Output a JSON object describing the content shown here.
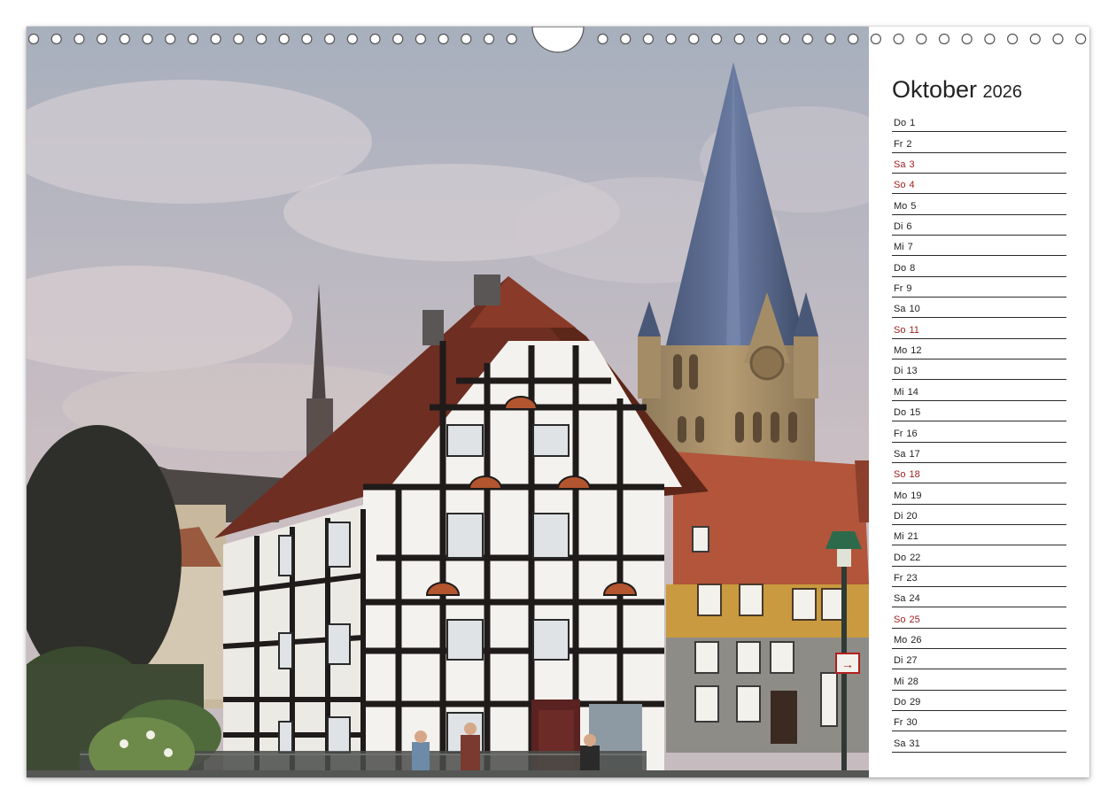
{
  "calendar": {
    "month": "Oktober",
    "year": "2026",
    "days": [
      {
        "wd": "Do",
        "n": "1",
        "weekend": false
      },
      {
        "wd": "Fr",
        "n": "2",
        "weekend": false
      },
      {
        "wd": "Sa",
        "n": "3",
        "weekend": true
      },
      {
        "wd": "So",
        "n": "4",
        "weekend": true
      },
      {
        "wd": "Mo",
        "n": "5",
        "weekend": false
      },
      {
        "wd": "Di",
        "n": "6",
        "weekend": false
      },
      {
        "wd": "Mi",
        "n": "7",
        "weekend": false
      },
      {
        "wd": "Do",
        "n": "8",
        "weekend": false
      },
      {
        "wd": "Fr",
        "n": "9",
        "weekend": false
      },
      {
        "wd": "Sa",
        "n": "10",
        "weekend": false
      },
      {
        "wd": "So",
        "n": "11",
        "weekend": true
      },
      {
        "wd": "Mo",
        "n": "12",
        "weekend": false
      },
      {
        "wd": "Di",
        "n": "13",
        "weekend": false
      },
      {
        "wd": "Mi",
        "n": "14",
        "weekend": false
      },
      {
        "wd": "Do",
        "n": "15",
        "weekend": false
      },
      {
        "wd": "Fr",
        "n": "16",
        "weekend": false
      },
      {
        "wd": "Sa",
        "n": "17",
        "weekend": false
      },
      {
        "wd": "So",
        "n": "18",
        "weekend": true
      },
      {
        "wd": "Mo",
        "n": "19",
        "weekend": false
      },
      {
        "wd": "Di",
        "n": "20",
        "weekend": false
      },
      {
        "wd": "Mi",
        "n": "21",
        "weekend": false
      },
      {
        "wd": "Do",
        "n": "22",
        "weekend": false
      },
      {
        "wd": "Fr",
        "n": "23",
        "weekend": false
      },
      {
        "wd": "Sa",
        "n": "24",
        "weekend": false
      },
      {
        "wd": "So",
        "n": "25",
        "weekend": true
      },
      {
        "wd": "Mo",
        "n": "26",
        "weekend": false
      },
      {
        "wd": "Di",
        "n": "27",
        "weekend": false
      },
      {
        "wd": "Mi",
        "n": "28",
        "weekend": false
      },
      {
        "wd": "Do",
        "n": "29",
        "weekend": false
      },
      {
        "wd": "Fr",
        "n": "30",
        "weekend": false
      },
      {
        "wd": "Sa",
        "n": "31",
        "weekend": false
      }
    ]
  },
  "photo": {
    "subject": "half-timbered-house-and-cathedral-tower",
    "sign_text": "→"
  },
  "colors": {
    "weekend": "#9b1c1c",
    "text": "#222222",
    "rule": "#2a2a2a"
  },
  "binding": {
    "ring_icon": "wire-ring-icon",
    "hanger_icon": "hanger-notch-icon"
  }
}
